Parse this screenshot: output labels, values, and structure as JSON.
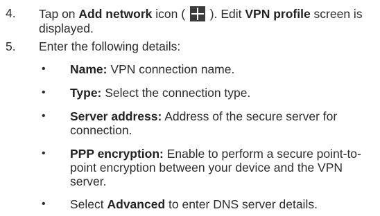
{
  "steps": [
    {
      "number": "4.",
      "pre": "Tap on ",
      "bold1": "Add network",
      "mid1": " icon ( ",
      "mid2": " ). Edit ",
      "bold2": "VPN profile",
      "post": " screen is displayed.",
      "icon": "plus-icon"
    },
    {
      "number": "5.",
      "text": "Enter the following details:"
    }
  ],
  "bullets": [
    {
      "bold": "Name:",
      "text": " VPN connection name."
    },
    {
      "bold": "Type:",
      "text": " Select the connection type."
    },
    {
      "bold": "Server address:",
      "text": " Address of the secure server for connection."
    },
    {
      "bold": "PPP encryption:",
      "text": " Enable to perform a secure point-to-point encryption between your device and the VPN server."
    },
    {
      "pre": "Select ",
      "bold": "Advanced",
      "text": " to enter DNS server details."
    }
  ],
  "bullet_glyph": "•"
}
